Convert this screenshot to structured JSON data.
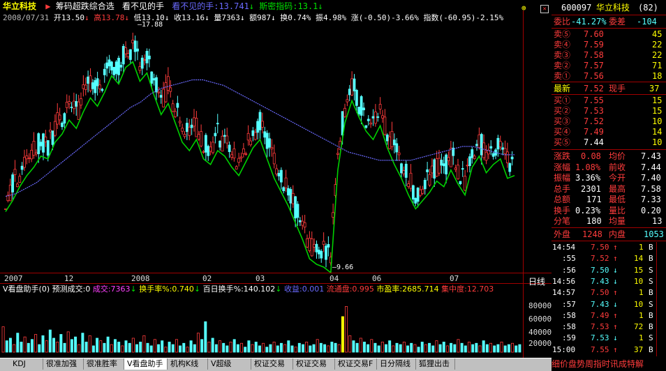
{
  "header": {
    "title": "华立科技",
    "indicator_name": "筹码超跌综合选",
    "indicator_sub": "看不见的手",
    "invisible_hand_label": "看不见的手:13.741",
    "snm_label": "斯密指码:13.1"
  },
  "quote_line": {
    "date": "2008/07/31",
    "open": "开13.50",
    "high": "高13.78",
    "low": "低13.10",
    "close": "收13.16",
    "volume": "量7363",
    "amount": "额987",
    "turnover": "换0.74%",
    "amplitude": "振4.98%",
    "change": "涨(-0.50)-3.66%",
    "index": "指数(-60.95)-2.15%"
  },
  "annotations": {
    "high": "17.88",
    "low": "9.66"
  },
  "x_axis": {
    "labels": [
      "2007",
      "12",
      "2008",
      "02",
      "03",
      "04",
      "06",
      "07"
    ],
    "period": "日线"
  },
  "volume_header": {
    "name": "V看盘助手(0)",
    "forecast": "预测成交:0",
    "vol": "成交:7363",
    "turnover": "换手率%:0.740",
    "turnover100": "百日换手%:140.102",
    "profit": "收益:0.001",
    "float": "流通盘:0.995",
    "pe": "市盈率:2685.714",
    "concentration": "集中度:12.703"
  },
  "volume_axis": [
    "80000",
    "60000",
    "40000",
    "20000"
  ],
  "panel": {
    "code": "600097",
    "name": "华立科技",
    "code_suffix": "(82)",
    "commission_ratio_label": "委比",
    "commission_ratio": "-41.27%",
    "commission_diff_label": "委差",
    "commission_diff": "-104",
    "sells": [
      {
        "label": "卖⑤",
        "price": "7.60",
        "vol": "45"
      },
      {
        "label": "卖④",
        "price": "7.59",
        "vol": "22"
      },
      {
        "label": "卖③",
        "price": "7.58",
        "vol": "22"
      },
      {
        "label": "卖②",
        "price": "7.57",
        "vol": "71"
      },
      {
        "label": "卖①",
        "price": "7.56",
        "vol": "18"
      }
    ],
    "latest_label": "最新",
    "latest": "7.52",
    "current_hand_label": "现手",
    "current_hand": "37",
    "buys": [
      {
        "label": "买①",
        "price": "7.55",
        "vol": "15"
      },
      {
        "label": "买②",
        "price": "7.53",
        "vol": "15"
      },
      {
        "label": "买③",
        "price": "7.52",
        "vol": "10"
      },
      {
        "label": "买④",
        "price": "7.49",
        "vol": "14"
      },
      {
        "label": "买⑤",
        "price": "7.44",
        "vol": "10"
      }
    ],
    "stats": [
      {
        "l1": "涨跌",
        "v1": "0.08",
        "l2": "均价",
        "v2": "7.43"
      },
      {
        "l1": "涨幅",
        "v1": "1.08%",
        "l2": "前收",
        "v2": "7.44"
      },
      {
        "l1": "振幅",
        "v1": "3.36%",
        "l2": "今开",
        "v2": "7.40"
      },
      {
        "l1": "总手",
        "v1": "2301",
        "l2": "最高",
        "v2": "7.58"
      },
      {
        "l1": "总额",
        "v1": "171",
        "l2": "最低",
        "v2": "7.33"
      },
      {
        "l1": "换手",
        "v1": "0.23%",
        "l2": "量比",
        "v2": "0.20"
      },
      {
        "l1": "分笔",
        "v1": "180",
        "l2": "均量",
        "v2": "13"
      }
    ],
    "outer_label": "外盘",
    "outer": "1248",
    "inner_label": "内盘",
    "inner": "1053",
    "ticks": [
      {
        "time": "14:54",
        "price": "7.50",
        "vol": "1",
        "dir": "B"
      },
      {
        "time": ":55",
        "price": "7.52",
        "vol": "14",
        "dir": "B"
      },
      {
        "time": ":56",
        "price": "7.50",
        "vol": "15",
        "dir": "S"
      },
      {
        "time": "14:56",
        "price": "7.43",
        "vol": "10",
        "dir": "S"
      },
      {
        "time": "14:57",
        "price": "7.50",
        "vol": "1",
        "dir": "B"
      },
      {
        "time": ":57",
        "price": "7.43",
        "vol": "10",
        "dir": "S"
      },
      {
        "time": ":58",
        "price": "7.49",
        "vol": "1",
        "dir": "B"
      },
      {
        "time": ":58",
        "price": "7.53",
        "vol": "72",
        "dir": "B"
      },
      {
        "time": ":59",
        "price": "7.53",
        "vol": "1",
        "dir": "S"
      },
      {
        "time": "15:00",
        "price": "7.55",
        "vol": "37",
        "dir": "B"
      }
    ]
  },
  "tabs": [
    "KDJ",
    "很准加强",
    "很准胜率",
    "V看盘助手",
    "机构K线(修",
    "V超级MACD",
    "权证交易B",
    "权证交易C",
    "权证交易F",
    "日分隔线",
    "狐狸出击"
  ],
  "marquee": "细价盘势周指时讯成特解",
  "chart_data": [
    {
      "type": "candlestick",
      "x_labels": [
        "2007",
        "12",
        "2008",
        "02",
        "03",
        "04",
        "06",
        "07"
      ],
      "annotations": [
        {
          "label": "17.88",
          "kind": "high"
        },
        {
          "label": "9.66",
          "kind": "low"
        }
      ],
      "close_path": [
        12.0,
        12.4,
        12.9,
        13.3,
        13.6,
        14.0,
        13.9,
        14.5,
        14.8,
        15.3,
        15.0,
        15.6,
        16.1,
        15.8,
        16.3,
        16.9,
        16.6,
        17.2,
        17.4,
        16.7,
        17.0,
        16.2,
        15.5,
        15.9,
        15.2,
        14.5,
        14.2,
        14.6,
        13.9,
        13.7,
        14.2,
        14.0,
        13.6,
        13.3,
        13.8,
        14.3,
        14.6,
        13.9,
        13.2,
        12.7,
        12.2,
        11.6,
        11.0,
        10.3,
        10.1,
        10.0,
        9.8,
        13.5,
        15.2,
        16.0,
        15.4,
        14.9,
        14.6,
        15.1,
        14.3,
        13.7,
        13.2,
        12.6,
        12.1,
        12.4,
        12.7,
        13.1,
        12.9,
        13.5,
        13.0,
        12.6,
        13.6,
        14.0,
        13.4,
        13.7,
        13.9,
        13.2,
        13.3
      ],
      "ma_path": [
        12.0,
        12.1,
        12.3,
        12.5,
        12.8,
        13.1,
        13.4,
        13.7,
        14.0,
        14.3,
        14.6,
        14.9,
        15.2,
        15.4,
        15.7,
        15.9,
        16.0,
        16.1,
        16.2,
        16.2,
        16.1,
        16.0,
        15.8,
        15.6,
        15.4,
        15.2,
        15.0,
        14.8,
        14.6,
        14.4,
        14.2,
        14.0,
        13.8,
        13.6,
        13.5,
        13.4,
        13.3,
        13.3,
        13.3,
        13.3,
        13.4,
        13.5,
        13.6,
        13.7,
        13.8,
        13.8,
        13.7,
        13.6,
        13.5,
        13.5
      ]
    },
    {
      "type": "bar",
      "yticks": [
        80000,
        60000,
        40000,
        20000
      ],
      "values": [
        40000,
        18000,
        22000,
        12000,
        30000,
        16000,
        24000,
        14000,
        20000,
        28000,
        12000,
        26000,
        18000,
        35000,
        22000,
        16000,
        28000,
        14000,
        32000,
        20000,
        24000,
        12000,
        30000,
        16000,
        26000,
        10000,
        22000,
        18000,
        14000,
        24000,
        12000,
        20000,
        16000,
        10000,
        18000,
        14000,
        22000,
        12000,
        16000,
        26000,
        14000,
        10000,
        20000,
        12000,
        18000,
        8000,
        16000,
        12000,
        20000,
        10000,
        14000,
        8000,
        18000,
        12000,
        30000,
        20000,
        48000,
        16000,
        22000,
        12000,
        18000,
        14000,
        10000,
        16000,
        20000,
        12000,
        14000,
        8000,
        18000,
        12000,
        16000,
        10000,
        14000,
        8000,
        12000,
        16000,
        10000,
        14000,
        12000,
        18000,
        10000,
        8000,
        14000,
        12000,
        16000,
        10000,
        12000,
        20000,
        14000,
        12000,
        10000,
        16000,
        14000,
        12000,
        56000,
        72000,
        26000,
        18000,
        14000,
        22000,
        16000,
        12000,
        20000,
        14000,
        10000,
        16000,
        12000,
        18000,
        10000,
        14000,
        12000,
        16000,
        10000,
        14000,
        12000,
        8000,
        16000,
        12000,
        14000,
        10000,
        18000,
        12000,
        16000,
        10000,
        14000,
        12000,
        20000,
        14000,
        10000,
        16000,
        12000,
        14000,
        10000,
        18000,
        12000,
        14000,
        10000,
        12000,
        16000,
        10000,
        12000,
        14000,
        10000,
        12000
      ]
    }
  ]
}
